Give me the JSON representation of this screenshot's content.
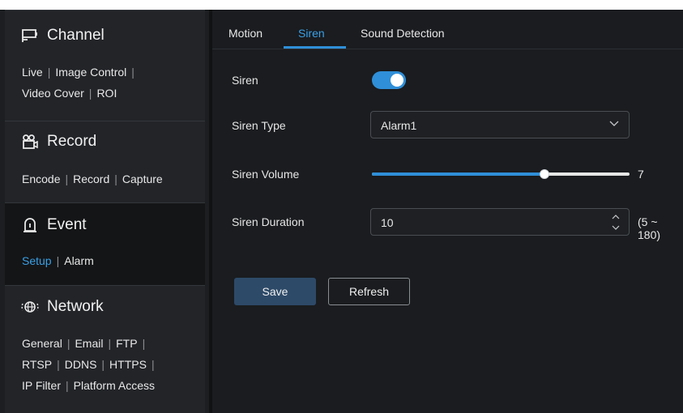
{
  "sidebar": {
    "channel": {
      "title": "Channel",
      "icon": "channel-icon",
      "links": [
        "Live",
        "Image Control",
        "Video Cover",
        "ROI"
      ]
    },
    "record": {
      "title": "Record",
      "icon": "record-icon",
      "links": [
        "Encode",
        "Record",
        "Capture"
      ]
    },
    "event": {
      "title": "Event",
      "icon": "event-icon",
      "links": [
        "Setup",
        "Alarm"
      ]
    },
    "network": {
      "title": "Network",
      "icon": "network-icon",
      "links": [
        "General",
        "Email",
        "FTP",
        "RTSP",
        "DDNS",
        "HTTPS",
        "IP Filter",
        "Platform Access"
      ]
    }
  },
  "tabs": [
    "Motion",
    "Siren",
    "Sound Detection"
  ],
  "active_tab": "Siren",
  "form": {
    "siren_label": "Siren",
    "siren_enabled": true,
    "siren_type_label": "Siren Type",
    "siren_type_value": "Alarm1",
    "siren_volume_label": "Siren Volume",
    "siren_volume_value": "7",
    "siren_volume_fraction": 0.67,
    "siren_duration_label": "Siren Duration",
    "siren_duration_value": "10",
    "siren_duration_range": "(5 ~ 180)"
  },
  "buttons": {
    "save": "Save",
    "refresh": "Refresh"
  },
  "colors": {
    "accent": "#2f8fd8",
    "active_link": "#3aa0e6",
    "save_bg": "#2d4a68"
  }
}
